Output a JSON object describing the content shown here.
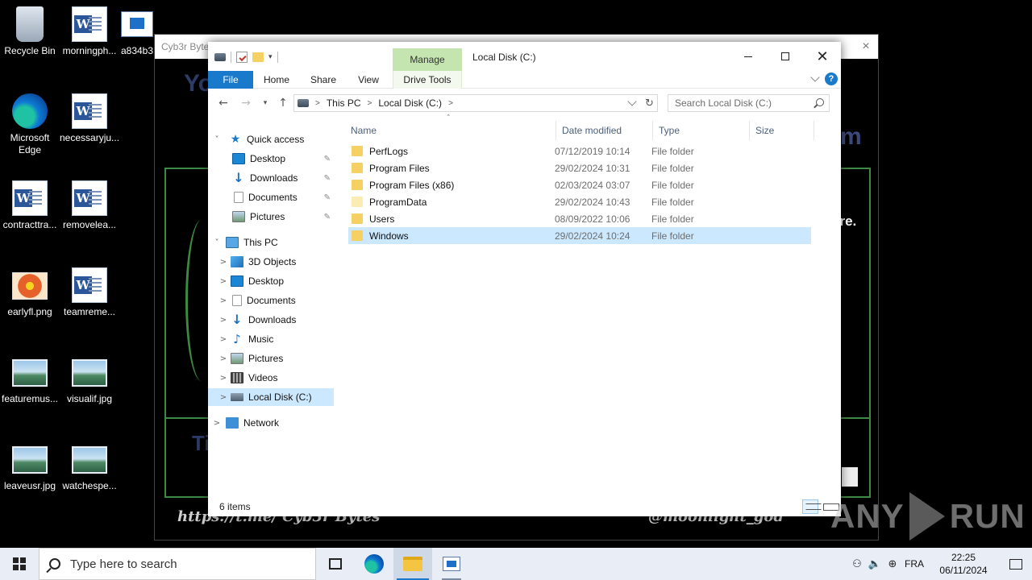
{
  "desktop": {
    "icons": [
      {
        "label": "Recycle Bin",
        "icon": "recycle-bin-icon"
      },
      {
        "label": "morningph...",
        "icon": "word-doc-icon"
      },
      {
        "label": "a834b3",
        "icon": "app-icon"
      },
      {
        "label": "Microsoft Edge",
        "icon": "edge-icon"
      },
      {
        "label": "necessaryju...",
        "icon": "word-doc-icon"
      },
      {
        "label": "contracttra...",
        "icon": "word-doc-icon"
      },
      {
        "label": "removelea...",
        "icon": "word-doc-icon"
      },
      {
        "label": "earlyfl.png",
        "icon": "image-icon"
      },
      {
        "label": "teamreme...",
        "icon": "word-doc-icon"
      },
      {
        "label": "featuremus...",
        "icon": "image-icon"
      },
      {
        "label": "visualif.jpg",
        "icon": "image-icon"
      },
      {
        "label": "leaveusr.jpg",
        "icon": "image-icon"
      },
      {
        "label": "watchespe...",
        "icon": "image-icon"
      }
    ]
  },
  "background_window": {
    "title": "Cyb3r Bytes Ransomware",
    "big_text_left": "Yo",
    "big_text_right": "m",
    "big_text_lower": "Ti",
    "white_text": "are.",
    "footer_left": "https://t.me/ Cyb3r Bytes",
    "footer_right": "Developed by @moonlight_god"
  },
  "explorer": {
    "title": "Local Disk (C:)",
    "manage_tab": "Manage",
    "ribbon_tabs": [
      "File",
      "Home",
      "Share",
      "View",
      "Drive Tools"
    ],
    "address": {
      "crumbs": [
        "This PC",
        "Local Disk (C:)"
      ]
    },
    "search_placeholder": "Search Local Disk (C:)",
    "nav": {
      "quick_access": "Quick access",
      "quick_items": [
        "Desktop",
        "Downloads",
        "Documents",
        "Pictures"
      ],
      "this_pc": "This PC",
      "pc_items": [
        "3D Objects",
        "Desktop",
        "Documents",
        "Downloads",
        "Music",
        "Pictures",
        "Videos",
        "Local Disk (C:)"
      ],
      "network": "Network"
    },
    "columns": [
      "Name",
      "Date modified",
      "Type",
      "Size"
    ],
    "files": [
      {
        "name": "PerfLogs",
        "date": "07/12/2019 10:14",
        "type": "File folder"
      },
      {
        "name": "Program Files",
        "date": "29/02/2024 10:31",
        "type": "File folder"
      },
      {
        "name": "Program Files (x86)",
        "date": "02/03/2024 03:07",
        "type": "File folder"
      },
      {
        "name": "ProgramData",
        "date": "29/02/2024 10:43",
        "type": "File folder"
      },
      {
        "name": "Users",
        "date": "08/09/2022 10:06",
        "type": "File folder"
      },
      {
        "name": "Windows",
        "date": "29/02/2024 10:24",
        "type": "File folder"
      }
    ],
    "status": "6 items"
  },
  "watermark": {
    "left": "ANY",
    "right": "RUN"
  },
  "taskbar": {
    "search_placeholder": "Type here to search",
    "language": "FRA",
    "time": "22:25",
    "date": "06/11/2024"
  }
}
